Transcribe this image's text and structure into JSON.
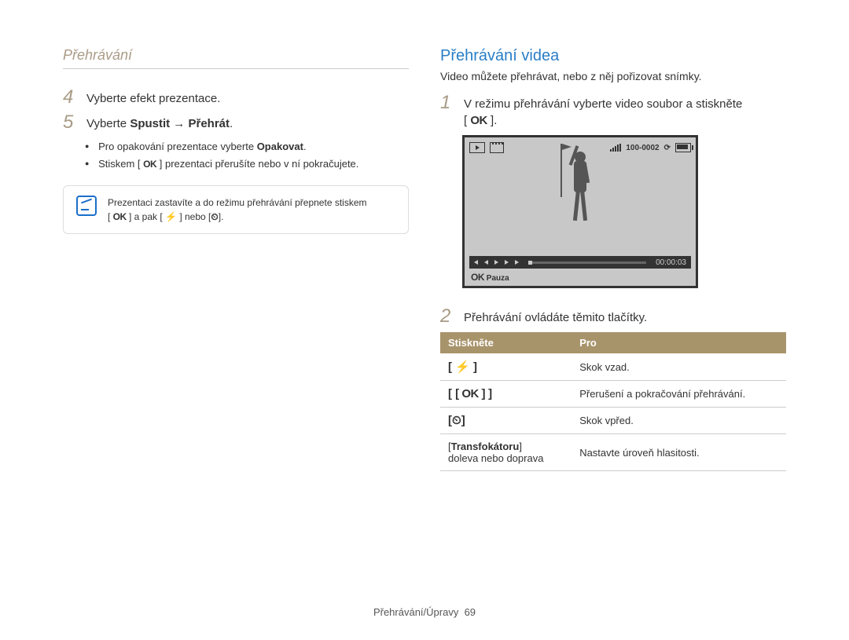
{
  "header": {
    "title": "Přehrávání"
  },
  "left": {
    "step4": {
      "num": "4",
      "text": "Vyberte efekt prezentace."
    },
    "step5": {
      "num": "5",
      "text_pre": "Vyberte ",
      "text_bold": "Spustit → Přehrát",
      "text_post": "."
    },
    "bullets": {
      "b1_pre": "Pro opakování prezentace vyberte ",
      "b1_bold": "Opakovat",
      "b1_post": ".",
      "b2_pre": "Stiskem [ ",
      "b2_ok": "OK",
      "b2_post": " ] prezentaci přerušíte nebo v ní pokračujete."
    },
    "note": {
      "line1_pre": "Prezentaci zastavíte a do režimu přehrávání přepnete stiskem",
      "line2_pre": "[ ",
      "line2_ok": "OK",
      "line2_mid": " ] a pak [ ",
      "line2_flash": "⚡",
      "line2_or": " ] nebo [",
      "line2_timer": "⏲",
      "line2_end": "]."
    }
  },
  "right": {
    "title": "Přehrávání videa",
    "subtitle": "Video můžete přehrávat, nebo z něj pořizovat snímky.",
    "step1": {
      "num": "1",
      "text_pre": "V režimu přehrávání vyberte video soubor a stiskněte",
      "text_ok": "OK",
      "text_post": "."
    },
    "lcd": {
      "folder_file": "100-0002",
      "rec_icon": "⟳",
      "time": "00:00:03",
      "bottom_ok": "OK",
      "bottom_label": "Pauza"
    },
    "step2": {
      "num": "2",
      "text": "Přehrávání ovládáte těmito tlačítky."
    },
    "table": {
      "head1": "Stiskněte",
      "head2": "Pro",
      "rows": [
        {
          "btn": "[ ⚡ ]",
          "desc": "Skok vzad."
        },
        {
          "btn": "[ OK ]",
          "desc": "Přerušení a pokračování přehrávání."
        },
        {
          "btn": "[⏲]",
          "desc": "Skok vpřed."
        },
        {
          "btn_pre": "[",
          "btn_bold": "Transfokátoru",
          "btn_post": "]",
          "btn_line2": "doleva nebo doprava",
          "desc": "Nastavte úroveň hlasitosti."
        }
      ]
    }
  },
  "footer": {
    "text": "Přehrávání/Úpravy",
    "page": "69"
  }
}
